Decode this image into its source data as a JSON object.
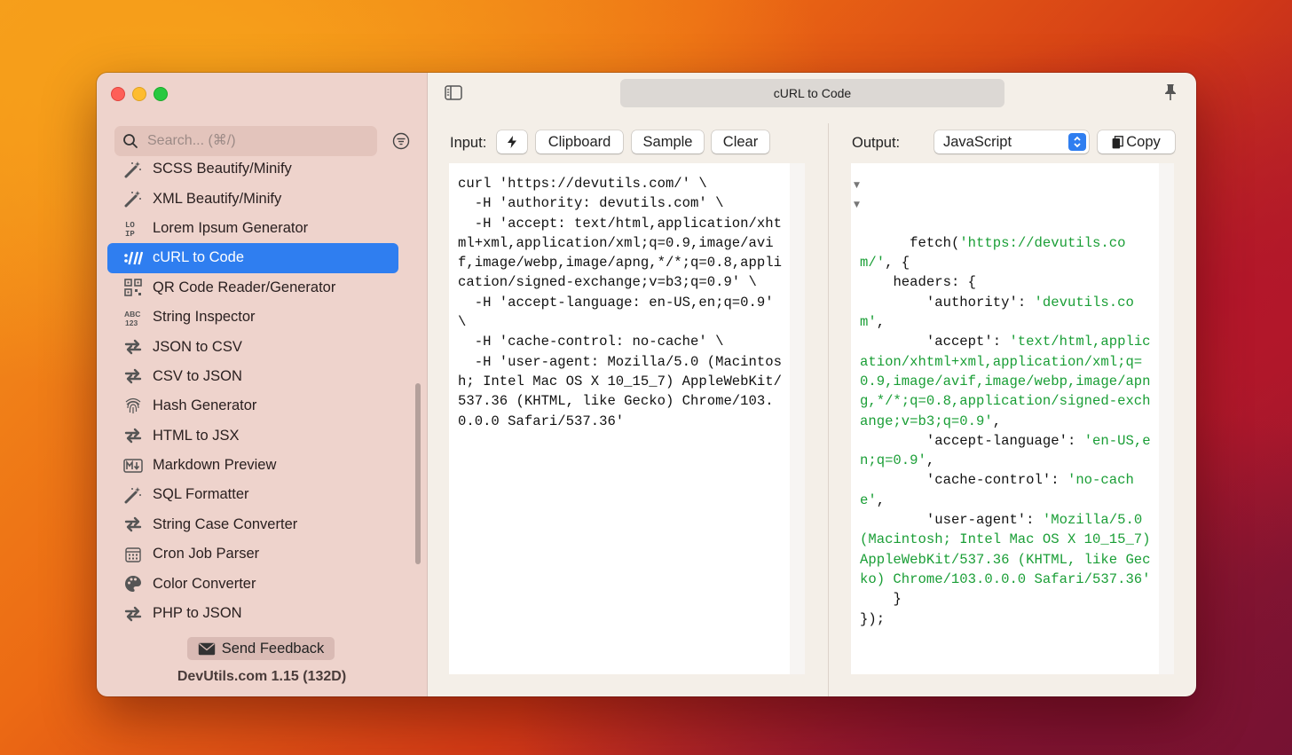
{
  "window": {
    "title": "cURL to Code"
  },
  "sidebar": {
    "search_placeholder": "Search... (⌘/)",
    "items": [
      {
        "label": "SCSS Beautify/Minify",
        "icon": "magic-wand-icon",
        "active": false
      },
      {
        "label": "XML Beautify/Minify",
        "icon": "magic-wand-icon",
        "active": false
      },
      {
        "label": "Lorem Ipsum Generator",
        "icon": "lorem-ipsum-icon",
        "active": false
      },
      {
        "label": "cURL to Code",
        "icon": "curl-icon",
        "active": true
      },
      {
        "label": "QR Code Reader/Generator",
        "icon": "qr-code-icon",
        "active": false
      },
      {
        "label": "String Inspector",
        "icon": "abc-123-icon",
        "active": false
      },
      {
        "label": "JSON to CSV",
        "icon": "convert-arrows-icon",
        "active": false
      },
      {
        "label": "CSV to JSON",
        "icon": "convert-arrows-icon",
        "active": false
      },
      {
        "label": "Hash Generator",
        "icon": "fingerprint-icon",
        "active": false
      },
      {
        "label": "HTML to JSX",
        "icon": "convert-arrows-icon",
        "active": false
      },
      {
        "label": "Markdown Preview",
        "icon": "markdown-icon",
        "active": false
      },
      {
        "label": "SQL Formatter",
        "icon": "magic-wand-icon",
        "active": false
      },
      {
        "label": "String Case Converter",
        "icon": "convert-arrows-icon",
        "active": false
      },
      {
        "label": "Cron Job Parser",
        "icon": "calendar-icon",
        "active": false
      },
      {
        "label": "Color Converter",
        "icon": "palette-icon",
        "active": false
      },
      {
        "label": "PHP to JSON",
        "icon": "convert-arrows-icon",
        "active": false
      }
    ],
    "send_feedback_label": "Send Feedback",
    "version_label": "DevUtils.com 1.15 (132D)"
  },
  "input": {
    "label": "Input:",
    "clipboard_label": "Clipboard",
    "sample_label": "Sample",
    "clear_label": "Clear",
    "code": "curl 'https://devutils.com/' \\\n  -H 'authority: devutils.com' \\\n  -H 'accept: text/html,application/xhtml+xml,application/xml;q=0.9,image/avif,image/webp,image/apng,*/*;q=0.8,application/signed-exchange;v=b3;q=0.9' \\\n  -H 'accept-language: en-US,en;q=0.9' \\\n  -H 'cache-control: no-cache' \\\n  -H 'user-agent: Mozilla/5.0 (Macintosh; Intel Mac OS X 10_15_7) AppleWebKit/537.36 (KHTML, like Gecko) Chrome/103.0.0.0 Safari/537.36'"
  },
  "output": {
    "label": "Output:",
    "language": "JavaScript",
    "copy_label": "Copy",
    "tokens": [
      {
        "t": "fetch(",
        "c": "p"
      },
      {
        "t": "'https://devutils.com/'",
        "c": "s"
      },
      {
        "t": ", {\n    headers: {\n        ",
        "c": "p"
      },
      {
        "t": "'authority'",
        "c": "p"
      },
      {
        "t": ": ",
        "c": "p"
      },
      {
        "t": "'devutils.com'",
        "c": "s"
      },
      {
        "t": ",\n        'accept': ",
        "c": "p"
      },
      {
        "t": "'text/html,application/xhtml+xml,application/xml;q=0.9,image/avif,image/webp,image/apng,*/*;q=0.8,application/signed-exchange;v=b3;q=0.9'",
        "c": "s"
      },
      {
        "t": ",\n        'accept-language': ",
        "c": "p"
      },
      {
        "t": "'en-US,en;q=0.9'",
        "c": "s"
      },
      {
        "t": ",\n        'cache-control': ",
        "c": "p"
      },
      {
        "t": "'no-cache'",
        "c": "s"
      },
      {
        "t": ",\n        'user-agent': ",
        "c": "p"
      },
      {
        "t": "'Mozilla/5.0 (Macintosh; Intel Mac OS X 10_15_7) AppleWebKit/537.36 (KHTML, like Gecko) Chrome/103.0.0.0 Safari/537.36'",
        "c": "s"
      },
      {
        "t": "\n    }\n});",
        "c": "p"
      }
    ]
  },
  "colors": {
    "accent": "#2f7ef0",
    "string": "#1a9e36"
  }
}
